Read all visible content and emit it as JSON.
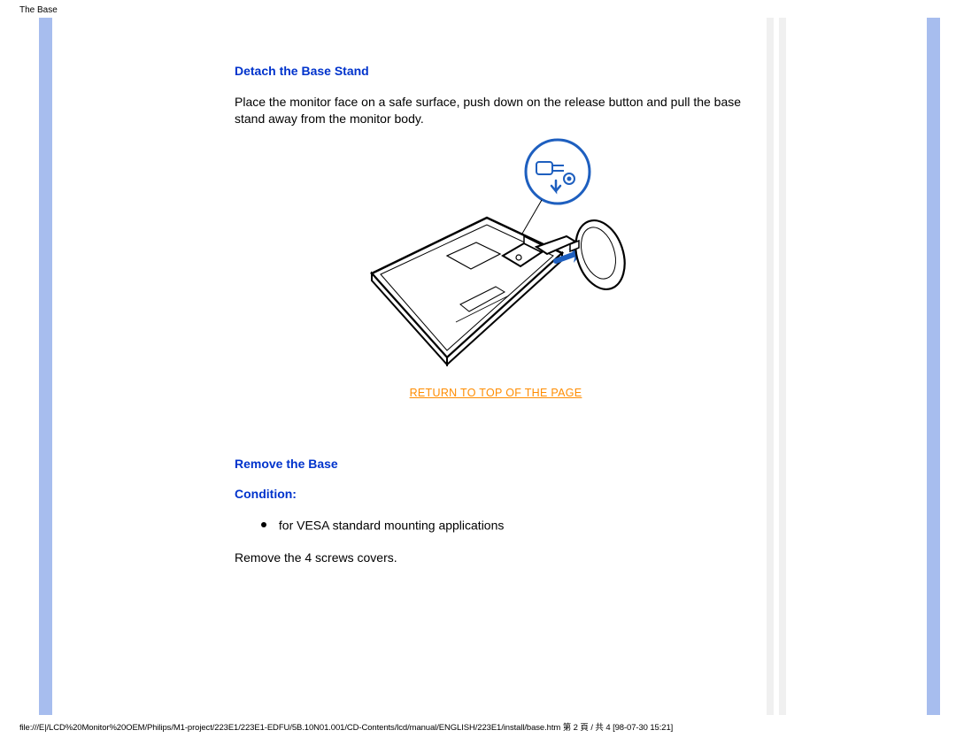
{
  "header": {
    "title": "The Base"
  },
  "section1": {
    "heading": "Detach the Base Stand",
    "paragraph": "Place the monitor face on a safe surface, push down on the release button and pull the base stand away from the monitor body."
  },
  "return_link": "RETURN TO TOP OF THE PAGE",
  "section2": {
    "heading": "Remove the Base",
    "condition_label": "Condition:",
    "bullet": "for VESA standard mounting applications",
    "instruction": "Remove the 4 screws covers."
  },
  "footer": {
    "path": "file:///E|/LCD%20Monitor%20OEM/Philips/M1-project/223E1/223E1-EDFU/5B.10N01.001/CD-Contents/lcd/manual/ENGLISH/223E1/install/base.htm 第 2 頁 / 共 4 [98-07-30 15:21]"
  }
}
